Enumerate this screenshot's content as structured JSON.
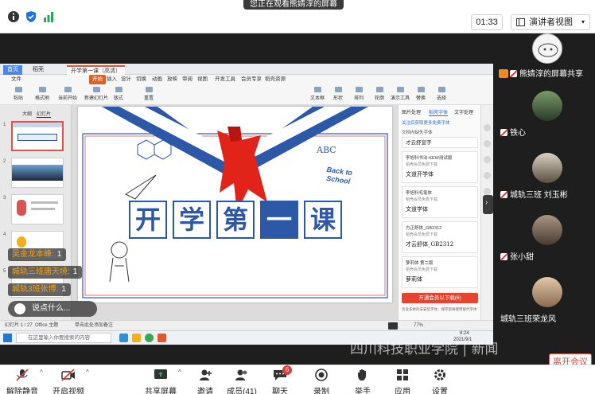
{
  "topbar": {
    "banner_text": "您正在观看熊婧淳的屏幕",
    "timer": "01:33",
    "view_button": "演讲者视图",
    "icons": [
      "info-icon",
      "shield-check-icon",
      "signal-bars-icon"
    ]
  },
  "app": {
    "tabs": [
      "首页",
      "稻壳",
      "开学第一课（高清）"
    ],
    "menu": [
      "文件",
      "开始",
      "插入",
      "设计",
      "切换",
      "动画",
      "放映",
      "审阅",
      "视图",
      "开发工具",
      "会员专享",
      "稻壳资源"
    ],
    "toolbar": [
      "粘贴",
      "格式刷",
      "当前开始",
      "新建幻灯片",
      "版式",
      "重置",
      "文本框",
      "形状",
      "排列",
      "轮廓",
      "演示工具",
      "替换",
      "选择"
    ],
    "slide_numbers": [
      "1",
      "2",
      "3",
      "4",
      "5"
    ],
    "thumb_tabs": [
      "大纲",
      "幻灯片"
    ],
    "slide": {
      "chars": [
        "开",
        "学",
        "第",
        "一",
        "课"
      ],
      "abc": "ABC",
      "back_to_school": "Back to School"
    },
    "right_panel": {
      "tabs": [
        "图片处理",
        "稻壳字体",
        "文字处理"
      ],
      "title": "关注后获取更多免费字体",
      "section": "文档内缺失字体",
      "missing_sample": "才云舒宣字",
      "fonts": [
        {
          "name": "李旭科书法-KEW测试版",
          "desc": "稻壳会员免费下载",
          "sample": "文道开学体"
        },
        {
          "name": "李旭科毛笔体",
          "desc": "稻壳会员免费下载",
          "sample": "文道学体"
        },
        {
          "name": "方正舒体_GB2312",
          "desc": "稻壳会员免费下载",
          "sample": "才云舒体_GB2312"
        },
        {
          "name": "萝莉体 第二版",
          "desc": "稻壳会员免费下载",
          "sample": "萝莉体"
        }
      ],
      "cta_button": "开通会员以下载(6)",
      "footer_note": "包含多余的未安装字体，保存后将使用替代字体"
    },
    "status": {
      "slide_pos": "幻灯片 1 / 27",
      "theme": "Office 主题",
      "notes": "单击此处添加备注",
      "zoom": "77%",
      "time": "8:24",
      "date": "2021/9/1"
    },
    "search_placeholder": "在这里输入你要搜索的内容"
  },
  "chat_overlay": {
    "messages": [
      {
        "name": "吴金龙本峰",
        "count": "1"
      },
      {
        "name": "城轨三班唐天境",
        "count": "1"
      },
      {
        "name": "城轨3班张博",
        "count": "1"
      }
    ],
    "input_placeholder": "说点什么..."
  },
  "gallery": {
    "participants": [
      {
        "name": "熊婧淳的屏幕共享"
      },
      {
        "name": "铁心"
      },
      {
        "name": "城轨三班 刘玉彬"
      },
      {
        "name": "张小甜"
      },
      {
        "name": "城轨三班荣龙风"
      }
    ]
  },
  "bottombar": {
    "buttons": [
      {
        "label": "解除静音",
        "icon": "muted-mic-icon"
      },
      {
        "label": "开启视频",
        "icon": "video-off-icon"
      },
      {
        "label": "共享屏幕",
        "icon": "share-screen-icon"
      },
      {
        "label": "邀请",
        "icon": "invite-icon"
      },
      {
        "label": "成员(41)",
        "icon": "members-icon"
      },
      {
        "label": "聊天",
        "icon": "chat-icon",
        "badge": "6"
      },
      {
        "label": "录制",
        "icon": "record-icon"
      },
      {
        "label": "举手",
        "icon": "raise-hand-icon"
      },
      {
        "label": "应用",
        "icon": "apps-icon"
      },
      {
        "label": "设置",
        "icon": "settings-icon"
      }
    ],
    "leave_button": "离开会议"
  },
  "watermark": "四川科技职业学院 | 新闻"
}
